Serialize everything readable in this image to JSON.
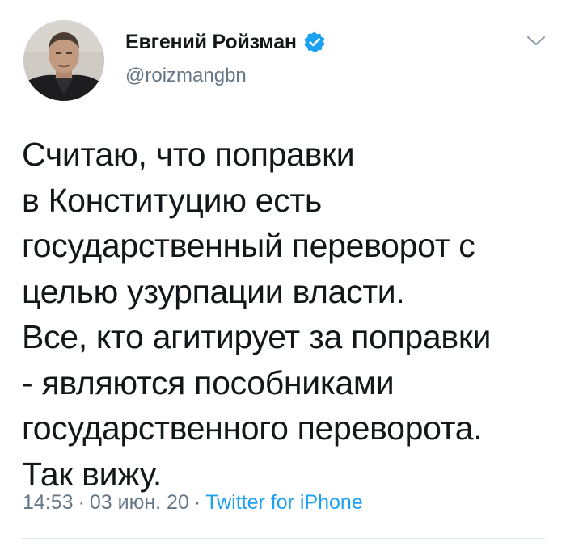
{
  "author": {
    "display_name": "Евгений Ройзман",
    "handle": "@roizmangbn",
    "verified": true,
    "avatar_icon": "profile-photo"
  },
  "menu_icon": "chevron-down-icon",
  "tweet": {
    "lines": [
      "Считаю, что поправки",
      "в Конституцию есть",
      "государственный переворот с",
      "целью узурпации власти.",
      "Все, кто агитирует за поправки",
      "- являются пособниками",
      "государственного переворота.",
      "Так вижу."
    ]
  },
  "meta": {
    "time": "14:53",
    "date": "03 июн. 20",
    "separator": "·",
    "source": "Twitter for iPhone"
  },
  "colors": {
    "text": "#14171a",
    "secondary": "#657786",
    "accent": "#1da1f2",
    "divider": "#e1e8ed"
  }
}
